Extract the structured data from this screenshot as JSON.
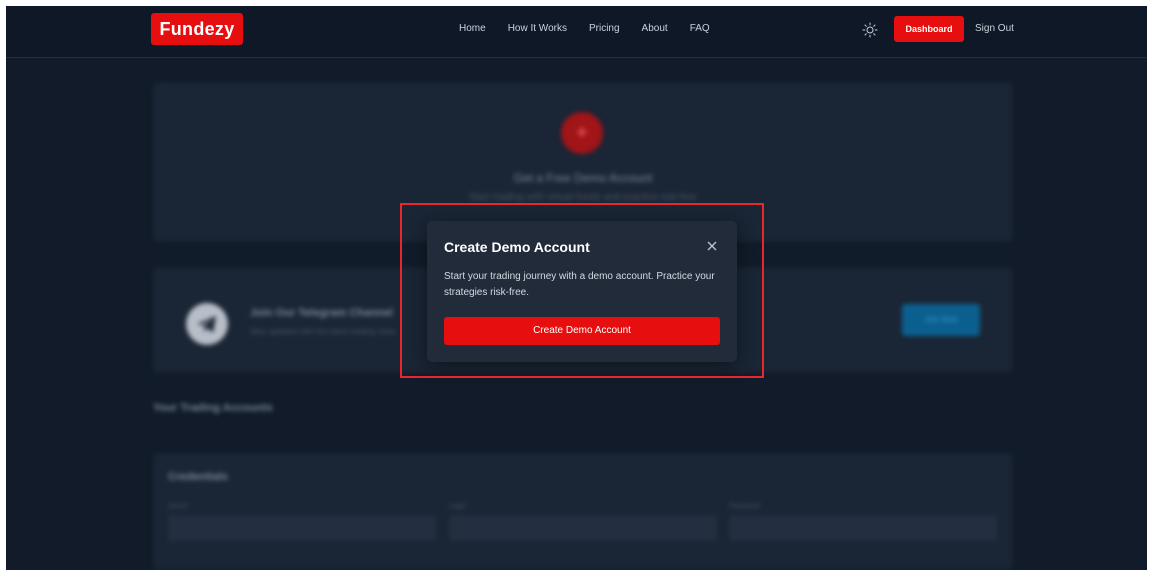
{
  "header": {
    "logo": "Fundezy",
    "nav": [
      "Home",
      "How It Works",
      "Pricing",
      "About",
      "FAQ"
    ],
    "theme_icon": "sun-icon",
    "dashboard_label": "Dashboard",
    "signout_label": "Sign Out"
  },
  "background": {
    "demo_card": {
      "icon": "plus-icon",
      "title": "Get a Free Demo Account",
      "subtitle": "Start trading with virtual funds and practice risk-free"
    },
    "telegram_card": {
      "icon": "telegram-icon",
      "title": "Join Our Telegram Channel",
      "subtitle": "Stay updated with the latest trading news",
      "button": "Join Now"
    },
    "section_title": "Your Trading Accounts",
    "credentials": {
      "title": "Credentials",
      "fields": [
        "Server",
        "Login",
        "Password"
      ]
    }
  },
  "modal": {
    "title": "Create Demo Account",
    "description": "Start your trading journey with a demo account. Practice your strategies risk-free.",
    "button": "Create Demo Account",
    "close_icon": "close-icon"
  },
  "colors": {
    "accent": "#e60e0e",
    "background": "#111b29",
    "modal_bg": "#212b3a",
    "highlight": "#e8262b"
  }
}
